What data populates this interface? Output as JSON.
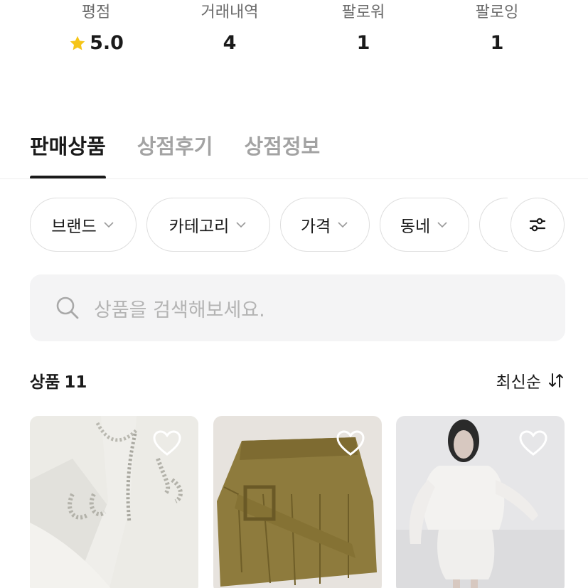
{
  "stats": [
    {
      "label": "평점",
      "value": "5.0",
      "icon": "star-icon"
    },
    {
      "label": "거래내역",
      "value": "4"
    },
    {
      "label": "팔로워",
      "value": "1"
    },
    {
      "label": "팔로잉",
      "value": "1"
    }
  ],
  "tabs": [
    {
      "label": "판매상품",
      "active": true
    },
    {
      "label": "상점후기",
      "active": false
    },
    {
      "label": "상점정보",
      "active": false
    }
  ],
  "filters": [
    {
      "label": "브랜드",
      "icon": "chevron-down-icon"
    },
    {
      "label": "카테고리",
      "icon": "chevron-down-icon"
    },
    {
      "label": "가격",
      "icon": "chevron-down-icon"
    },
    {
      "label": "동네",
      "icon": "chevron-down-icon"
    }
  ],
  "filter_settings_icon": "sliders-icon",
  "search": {
    "placeholder": "상품을 검색해보세요.",
    "icon": "search-icon"
  },
  "products_header": {
    "label": "상품",
    "count": "11"
  },
  "sort": {
    "label": "최신순",
    "icon": "sort-arrows-icon"
  },
  "products": [
    {
      "image": "white-jacket-pearl-trim-photo",
      "favorite_icon": "heart-outline-icon"
    },
    {
      "image": "khaki-pleated-skirt-photo",
      "favorite_icon": "heart-outline-icon"
    },
    {
      "image": "white-fur-jacket-model-photo",
      "favorite_icon": "heart-outline-icon"
    }
  ],
  "colors": {
    "accent_text": "#1a1a1a",
    "muted_text": "#a3a3a3",
    "star": "#f5c518",
    "search_bg": "#f4f4f5"
  }
}
